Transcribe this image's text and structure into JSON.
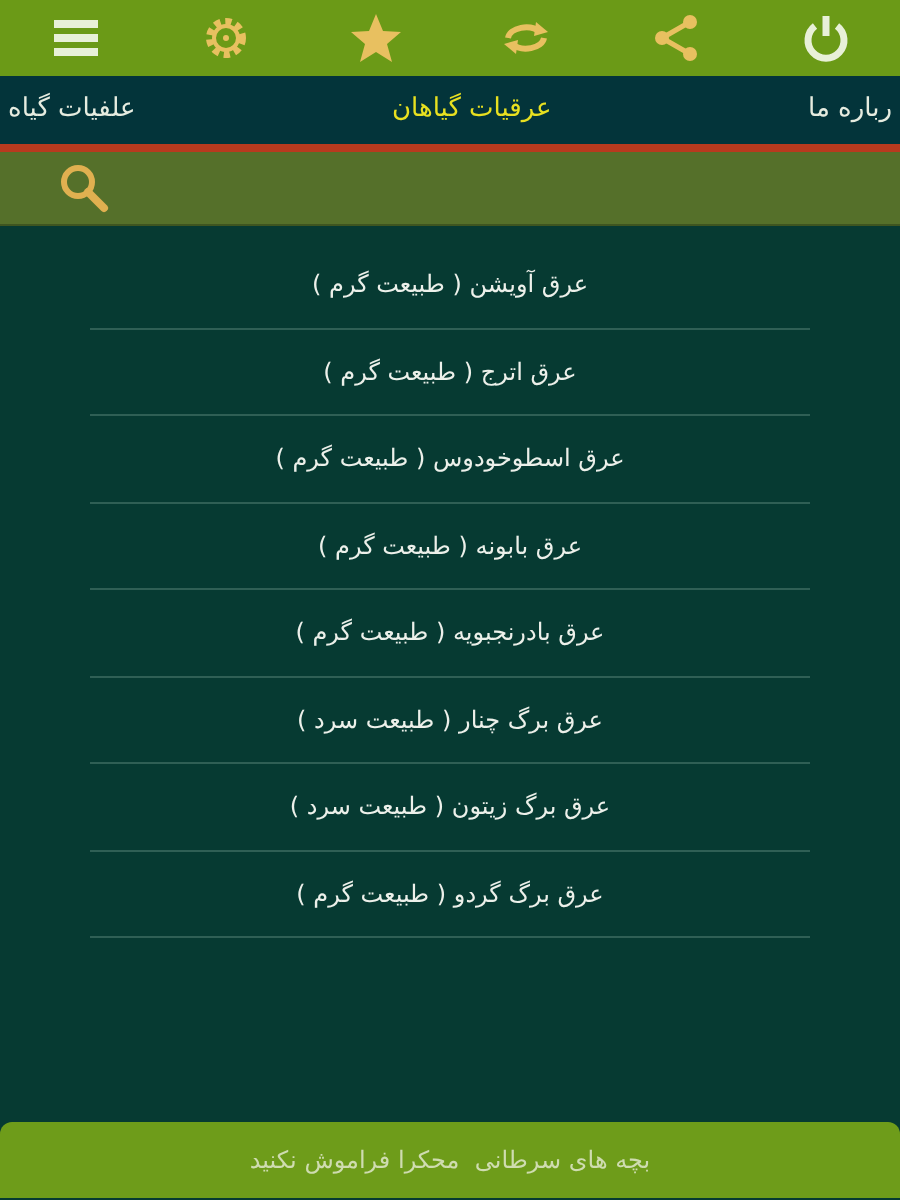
{
  "tabs": [
    {
      "label": "رباره ما",
      "selected": false
    },
    {
      "label": "عرقیات گیاهان",
      "selected": true
    },
    {
      "label": "علفیات گیاه",
      "selected": false
    }
  ],
  "items": [
    {
      "label": "عرق آویشن ( طبیعت گرم )"
    },
    {
      "label": "عرق اترج ( طبیعت گرم )"
    },
    {
      "label": "عرق اسطوخودوس ( طبیعت گرم )"
    },
    {
      "label": "عرق بابونه ( طبیعت گرم )"
    },
    {
      "label": "عرق بادرنجبویه ( طبیعت گرم )"
    },
    {
      "label": "عرق برگ چنار ( طبیعت سرد )"
    },
    {
      "label": "عرق برگ زیتون ( طبیعت سرد )"
    },
    {
      "label": "عرق برگ گردو ( طبیعت گرم )"
    }
  ],
  "banner": "بچه های سرطانی  محکرا فراموش نکنید"
}
